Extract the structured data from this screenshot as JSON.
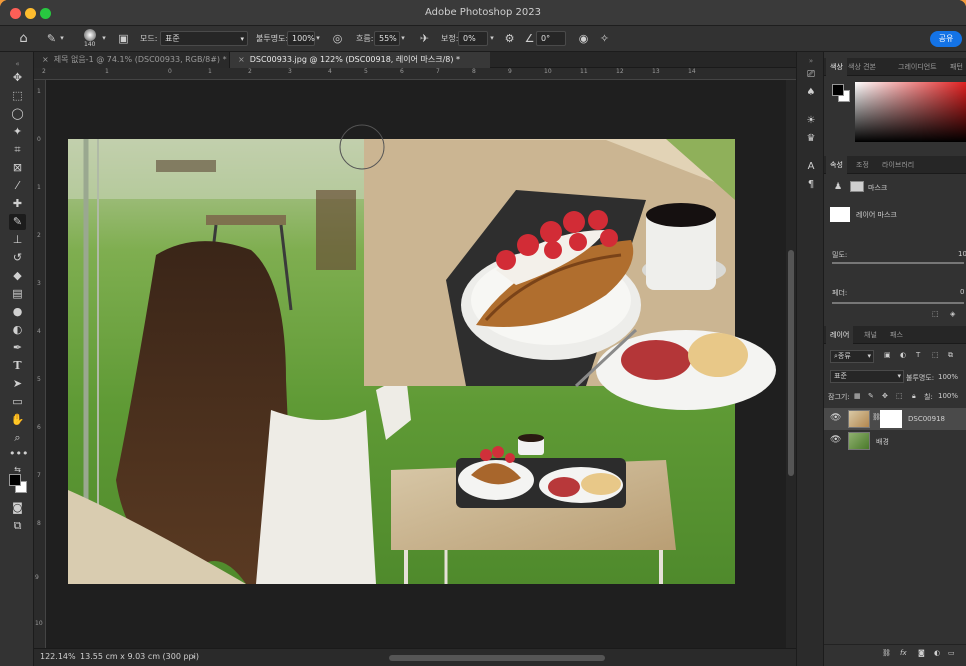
{
  "app": {
    "title": "Adobe Photoshop 2023"
  },
  "options": {
    "brush_size": "140",
    "mode_label": "모드:",
    "mode_value": "표준",
    "opacity_label": "불투명도:",
    "opacity_value": "100%",
    "flow_label": "흐름:",
    "flow_value": "55%",
    "smoothing_label": "보정:",
    "smoothing_value": "0%",
    "angle_value": "0°",
    "share_label": "공유"
  },
  "tabs": [
    {
      "label": "제목 없음-1 @ 74.1% (DSC00933, RGB/8#) *"
    },
    {
      "label": "DSC00933.jpg @ 122% (DSC00918, 레이어 마스크/8) *"
    }
  ],
  "ruler": {
    "h_labels": [
      "2",
      "1",
      "0",
      "1",
      "2",
      "3",
      "4",
      "5",
      "6",
      "7",
      "8",
      "9",
      "10",
      "11",
      "12",
      "13",
      "14"
    ],
    "v_labels": [
      "1",
      "0",
      "1",
      "2",
      "3",
      "4",
      "5",
      "6",
      "7",
      "8",
      "9",
      "10"
    ]
  },
  "status": {
    "zoom": "122.14%",
    "doc_info": "13.55 cm x 9.03 cm (300 ppi)"
  },
  "color_panel": {
    "tabs": [
      "색상",
      "색상 견본",
      "그레이디언트",
      "패턴"
    ]
  },
  "properties_panel": {
    "tabs": [
      "속성",
      "조정",
      "라이브러리"
    ],
    "mask_title": "마스크",
    "layer_mask_label": "레이어 마스크",
    "density_label": "밀도:",
    "density_value": "10",
    "feather_label": "페더:",
    "feather_value": "0"
  },
  "layers_panel": {
    "tabs": [
      "레이어",
      "채널",
      "패스"
    ],
    "filter_label": "종류",
    "blend_mode": "표준",
    "opacity_label": "불투명도:",
    "opacity_value": "100%",
    "lock_label": "잠그기:",
    "fill_label": "칠:",
    "fill_value": "100%",
    "layers": [
      {
        "name": "DSC00918",
        "selected": true
      },
      {
        "name": "배경",
        "selected": false
      }
    ]
  },
  "colors": {
    "accent": "#1473e6",
    "background": "#2d2d2d",
    "canvas_bg": "#1f1f1f"
  }
}
